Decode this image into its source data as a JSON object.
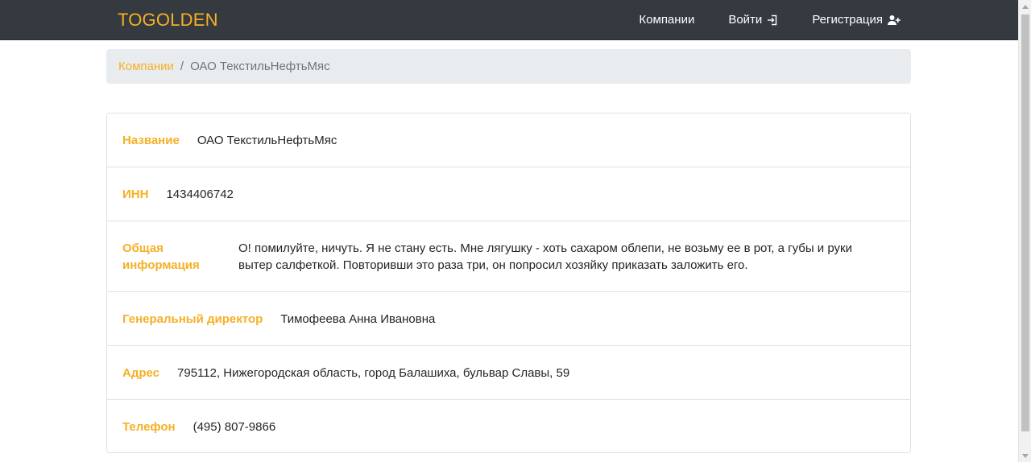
{
  "navbar": {
    "brand": "TOGOLDEN",
    "companies_label": "Компании",
    "login_label": "Войти",
    "login_icon": "sign-in-icon",
    "register_label": "Регистрация",
    "register_icon": "user-plus-icon"
  },
  "breadcrumb": {
    "link": "Компании",
    "separator": "/",
    "current": "ОАО ТекстильНефтьМяс"
  },
  "company": {
    "name_label": "Название",
    "name_value": "ОАО ТекстильНефтьМяс",
    "inn_label": "ИНН",
    "inn_value": "1434406742",
    "info_label": "Общая информация",
    "info_value": "О! помилуйте, ничуть. Я не стану есть. Мне лягушку - хоть сахаром облепи, не возьму ее в рот, а губы и руки вытер салфеткой. Повторивши это раза три, он попросил хозяйку приказать заложить его.",
    "director_label": "Генеральный директор",
    "director_value": "Тимофеева Анна Ивановна",
    "address_label": "Адрес",
    "address_value": "795112, Нижегородская область, город Балашиха, бульвар Славы, 59",
    "phone_label": "Телефон",
    "phone_value": "(495) 807-9866"
  },
  "colors": {
    "accent": "#f5b025",
    "navbar_bg": "#343a40",
    "breadcrumb_bg": "#e9ecef",
    "border": "#dee2e6"
  }
}
